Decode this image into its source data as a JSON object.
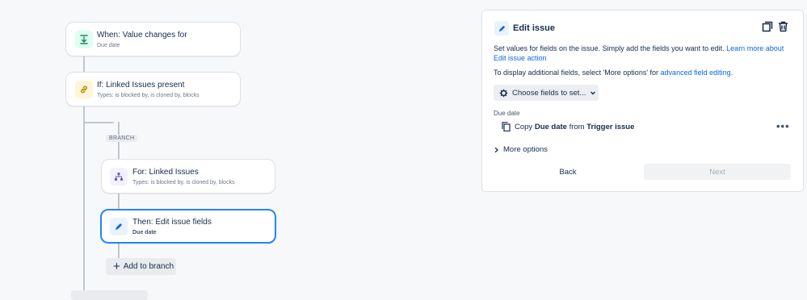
{
  "flow": {
    "trigger": {
      "title": "When: Value changes for",
      "subtitle": "Due date",
      "icon": "trigger-download-icon"
    },
    "condition": {
      "title": "If: Linked Issues present",
      "subtitle": "Types: is blocked by, is cloned by, blocks",
      "icon": "link-icon"
    },
    "branch_label": "BRANCH",
    "branch": {
      "title": "For: Linked Issues",
      "subtitle": "Types: is blocked by, is cloned by, blocks",
      "icon": "hierarchy-icon"
    },
    "action": {
      "title": "Then: Edit issue fields",
      "subtitle": "Due date",
      "icon": "pencil-icon"
    },
    "add_branch": "Add to branch"
  },
  "panel": {
    "title": "Edit issue",
    "desc1_text": "Set values for fields on the issue. Simply add the fields you want to edit. ",
    "desc1_link": "Learn more about Edit issue action",
    "desc2_text": "To display additional fields, select 'More options' for ",
    "desc2_link": "advanced field editing.",
    "choose_fields": "Choose fields to set...",
    "field_label": "Due date",
    "copy_prefix": "Copy",
    "copy_field": "Due date",
    "copy_mid": "from",
    "copy_source": "Trigger issue",
    "more_options": "More options",
    "back": "Back",
    "next": "Next"
  },
  "colors": {
    "accent": "#2684ff",
    "link": "#0c66e4",
    "trigger_bg": "#dcfff1",
    "condition_bg": "#fff4d6",
    "branch_bg": "#f3f0ff",
    "action_bg": "#e9f2ff"
  }
}
